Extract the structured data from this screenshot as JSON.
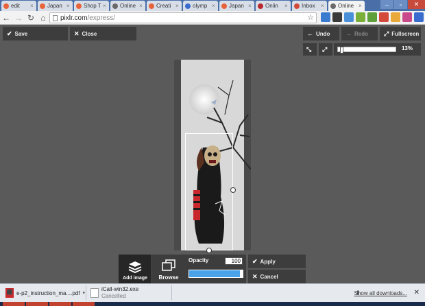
{
  "browser": {
    "tabs": [
      {
        "label": "edit",
        "favicon_color": "#e8623a"
      },
      {
        "label": "Japan",
        "favicon_color": "#e8623a"
      },
      {
        "label": "Shop T",
        "favicon_color": "#e8623a"
      },
      {
        "label": "Online",
        "favicon_color": "#6a6a6a"
      },
      {
        "label": "Creati",
        "favicon_color": "#e8623a"
      },
      {
        "label": "olymp",
        "favicon_color": "#3a6ccf"
      },
      {
        "label": "Japan",
        "favicon_color": "#e8623a"
      },
      {
        "label": "Onlin",
        "favicon_color": "#b8282c"
      },
      {
        "label": "Inbox",
        "favicon_color": "#d44a3a"
      },
      {
        "label": "Online",
        "favicon_color": "#6a6a6a",
        "active": true
      }
    ],
    "url_host": "pixlr.com",
    "url_path": "/express/"
  },
  "pixlr": {
    "save_label": "Save",
    "close_label": "Close",
    "undo_label": "Undo",
    "redo_label": "Redo",
    "fullscreen_label": "Fullscreen",
    "zoom_percent": "13%",
    "zoom_level": 0.04,
    "add_image_label": "Add image",
    "browse_label": "Browse",
    "opacity_label": "Opacity",
    "opacity_value": "100",
    "opacity_level": 1.0,
    "apply_label": "Apply",
    "cancel_label": "Cancel"
  },
  "downloads": {
    "items": [
      {
        "name": "e-p2_instruction_ma....pdf",
        "status": ""
      },
      {
        "name": "iCall-win32.exe",
        "status": "Cancelled"
      }
    ],
    "show_all_label": "Show all downloads..."
  }
}
